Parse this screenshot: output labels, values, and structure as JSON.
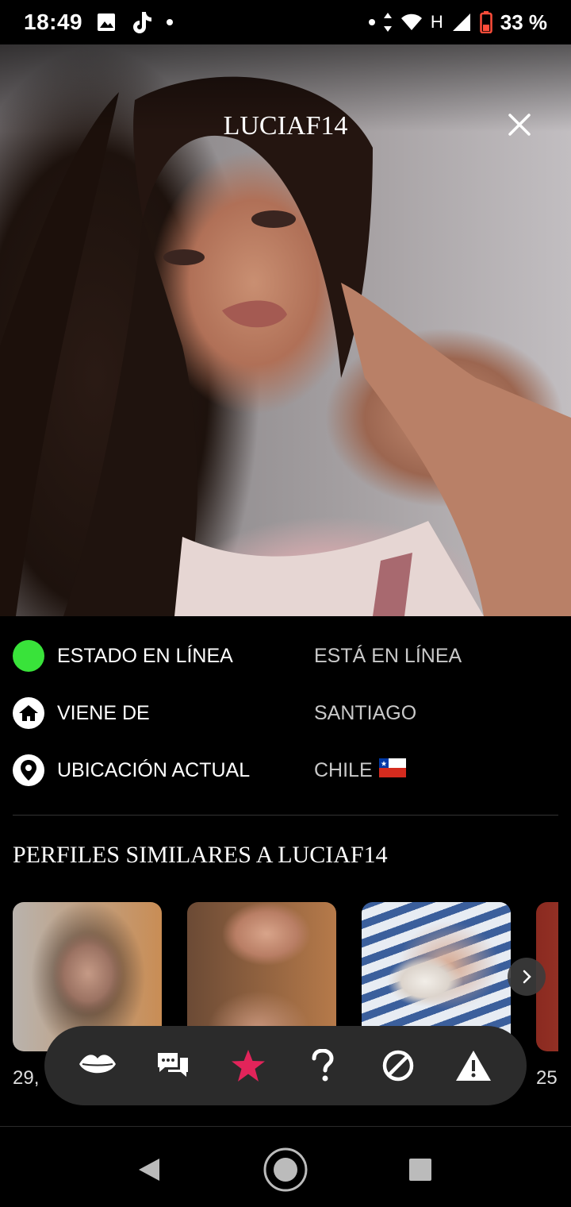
{
  "status_bar": {
    "time": "18:49",
    "network": "H",
    "battery": "33 %",
    "icons": [
      "image-icon",
      "tiktok-icon",
      "dot",
      "data-arrows-icon",
      "wifi-icon",
      "signal-icon",
      "battery-icon"
    ]
  },
  "profile": {
    "username": "LUCIAF14",
    "close_icon": "close-icon"
  },
  "info_rows": [
    {
      "icon": "online-status-icon",
      "label": "ESTADO EN LÍNEA",
      "value": "ESTÁ EN LÍNEA",
      "color": "#39e33a"
    },
    {
      "icon": "home-icon",
      "label": "VIENE DE",
      "value": "SANTIAGO"
    },
    {
      "icon": "location-pin-icon",
      "label": "UBICACIÓN ACTUAL",
      "value": "CHILE",
      "flag": "chile-flag-icon"
    }
  ],
  "similar": {
    "title": "PERFILES SIMILARES A LUCIAF14",
    "cards": [
      {
        "age": "29,"
      },
      {
        "age": ""
      },
      {
        "age": ""
      },
      {
        "age": "25"
      }
    ]
  },
  "actions": [
    {
      "name": "kiss-icon"
    },
    {
      "name": "chat-icon"
    },
    {
      "name": "favorite-star-icon",
      "color": "#e2245a"
    },
    {
      "name": "help-icon"
    },
    {
      "name": "block-icon"
    },
    {
      "name": "report-warning-icon"
    }
  ],
  "nav": [
    "back-icon",
    "home-circle-icon",
    "recents-icon"
  ]
}
